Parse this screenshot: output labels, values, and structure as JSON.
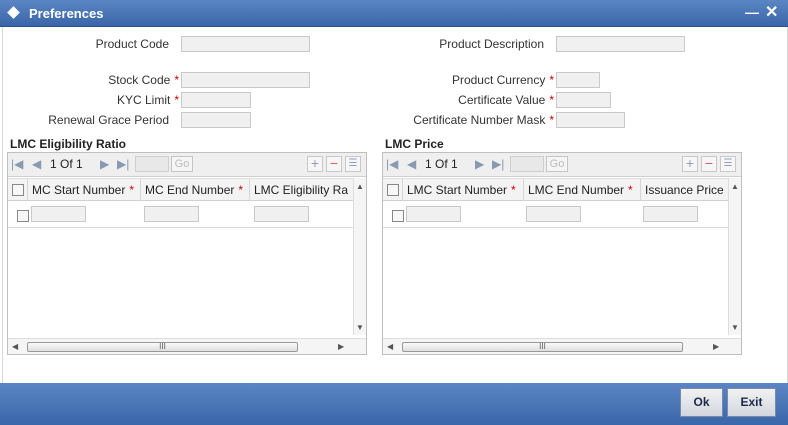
{
  "window": {
    "title": "Preferences"
  },
  "form": {
    "product_code_label": "Product Code",
    "product_description_label": "Product Description",
    "stock_code_label": "Stock Code",
    "product_currency_label": "Product Currency",
    "kyc_limit_label": "KYC Limit",
    "certificate_value_label": "Certificate Value",
    "renewal_grace_period_label": "Renewal Grace Period",
    "certificate_number_mask_label": "Certificate Number Mask",
    "required_marker": "*"
  },
  "eligibility": {
    "title": "LMC Eligibility Ratio",
    "page_current": "1",
    "page_of": "Of",
    "page_total": "1",
    "go_label": "Go",
    "columns": [
      "MC Start Number",
      "MC End Number",
      "LMC Eligibility Ra"
    ]
  },
  "price": {
    "title": "LMC Price",
    "page_current": "1",
    "page_of": "Of",
    "page_total": "1",
    "go_label": "Go",
    "columns": [
      "LMC Start Number",
      "LMC End Number",
      "Issuance Price"
    ]
  },
  "scroll": {
    "grip": "III"
  },
  "buttons": {
    "ok": "Ok",
    "exit": "Exit"
  }
}
